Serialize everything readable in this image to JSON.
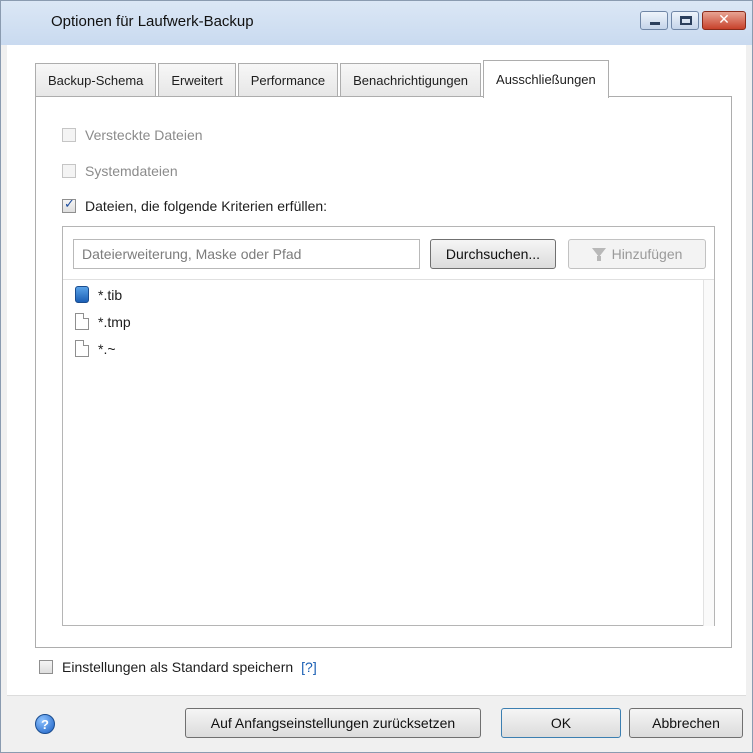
{
  "window": {
    "title": "Optionen für Laufwerk-Backup",
    "controls": {
      "minimize": "–",
      "maximize": "□",
      "close": "✕"
    }
  },
  "tabs": [
    {
      "label": "Backup-Schema",
      "active": false
    },
    {
      "label": "Erweitert",
      "active": false
    },
    {
      "label": "Performance",
      "active": false
    },
    {
      "label": "Benachrichtigungen",
      "active": false
    },
    {
      "label": "Ausschließungen",
      "active": true
    }
  ],
  "exclusions": {
    "hidden_files": {
      "label": "Versteckte Dateien",
      "checked": false,
      "enabled": false
    },
    "system_files": {
      "label": "Systemdateien",
      "checked": false,
      "enabled": false
    },
    "criteria_files": {
      "label": "Dateien, die folgende Kriterien erfüllen:",
      "checked": true,
      "enabled": true
    },
    "filter_input": {
      "placeholder": "Dateierweiterung, Maske oder Pfad",
      "value": ""
    },
    "browse_label": "Durchsuchen...",
    "add_label": "Hinzufügen",
    "items": [
      {
        "name": "*.tib",
        "icon": "tib-file-icon"
      },
      {
        "name": "*.tmp",
        "icon": "file-icon"
      },
      {
        "name": "*.~",
        "icon": "file-icon"
      }
    ]
  },
  "footer": {
    "save_default_label": "Einstellungen als Standard speichern",
    "help_link": "[?]",
    "reset_label": "Auf Anfangseinstellungen zurücksetzen",
    "ok_label": "OK",
    "cancel_label": "Abbrechen",
    "help_icon": "?"
  }
}
